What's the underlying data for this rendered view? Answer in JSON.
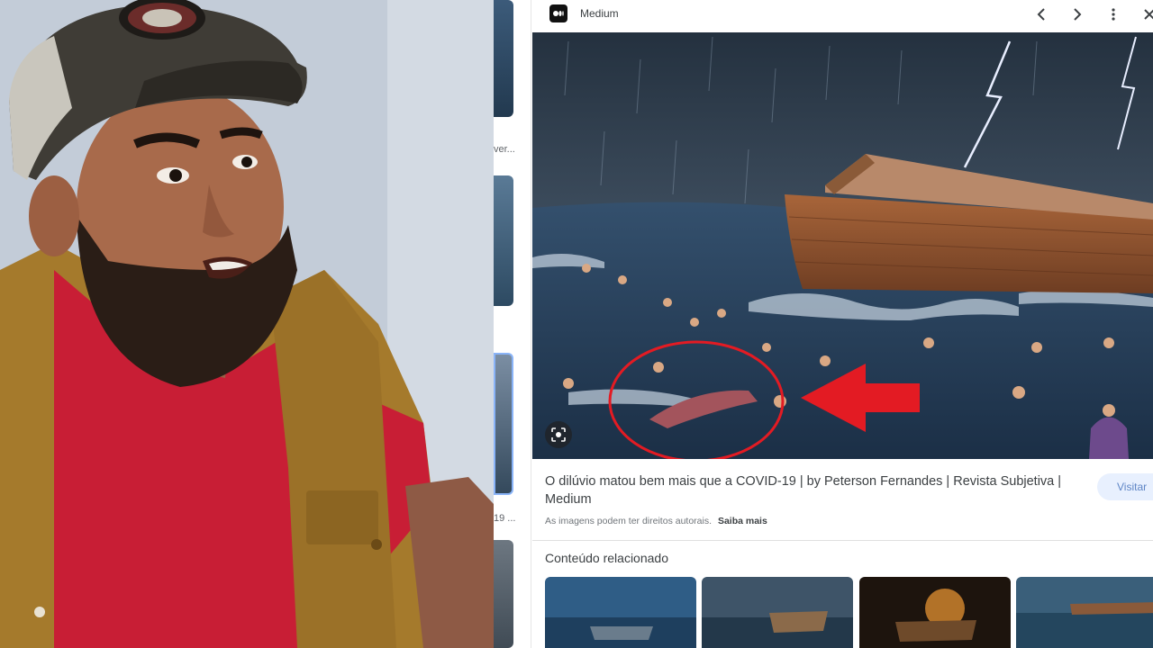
{
  "panel": {
    "site_name": "Medium",
    "result_title": "O dilúvio matou bem mais que a COVID-19 | by Peterson Fernandes | Revista Subjetiva | Medium",
    "rights_notice": "As imagens podem ter direitos autorais.",
    "learn_more": "Saiba mais",
    "visit_label": "Visitar",
    "related_heading": "Conteúdo relacionado",
    "icons": [
      "medium-logo-icon",
      "chevron-left-icon",
      "chevron-right-icon",
      "more-vert-icon",
      "close-icon",
      "lens-icon"
    ]
  },
  "results_strip": {
    "caption_1": "ver...",
    "caption_2": "19 ..."
  },
  "colors": {
    "accent_red": "#e31b23",
    "visit_button_bg": "#e8f0fe",
    "visit_button_text": "#5f86c6",
    "shirt_red": "#c81e35",
    "vest_mustard": "#a57a2c"
  }
}
